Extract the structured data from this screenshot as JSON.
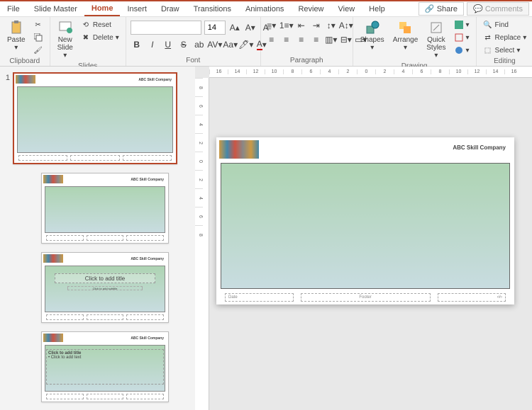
{
  "menu": {
    "tabs": [
      "File",
      "Slide Master",
      "Home",
      "Insert",
      "Draw",
      "Transitions",
      "Animations",
      "Review",
      "View",
      "Help"
    ],
    "active": "Home",
    "share": "Share",
    "comments": "Comments"
  },
  "ribbon": {
    "clipboard": {
      "label": "Clipboard",
      "paste": "Paste"
    },
    "slides": {
      "label": "Slides",
      "new_slide": "New\nSlide",
      "reset": "Reset",
      "delete": "Delete"
    },
    "font": {
      "label": "Font",
      "size": "14"
    },
    "paragraph": {
      "label": "Paragraph"
    },
    "drawing": {
      "label": "Drawing",
      "shapes": "Shapes",
      "arrange": "Arrange",
      "quick_styles": "Quick\nStyles"
    },
    "editing": {
      "label": "Editing",
      "find": "Find",
      "replace": "Replace",
      "select": "Select"
    }
  },
  "thumbnails": {
    "master_num": "1",
    "company": "ABC Skill Company",
    "layout2_title": "Click to add title",
    "layout2_sub": "Click to add subtitle",
    "layout3_title": "Click to add title",
    "layout3_text": "• Click to add text"
  },
  "canvas": {
    "company": "ABC Skill Company",
    "date_ph": "Date",
    "footer_ph": "Footer",
    "num_ph": "‹#›"
  },
  "ruler_marks": [
    "16",
    "14",
    "12",
    "10",
    "8",
    "6",
    "4",
    "2",
    "0",
    "2",
    "4",
    "6",
    "8",
    "10",
    "12",
    "14",
    "16"
  ],
  "ruler_v_marks": [
    "8",
    "6",
    "4",
    "2",
    "0",
    "2",
    "4",
    "6",
    "8"
  ]
}
